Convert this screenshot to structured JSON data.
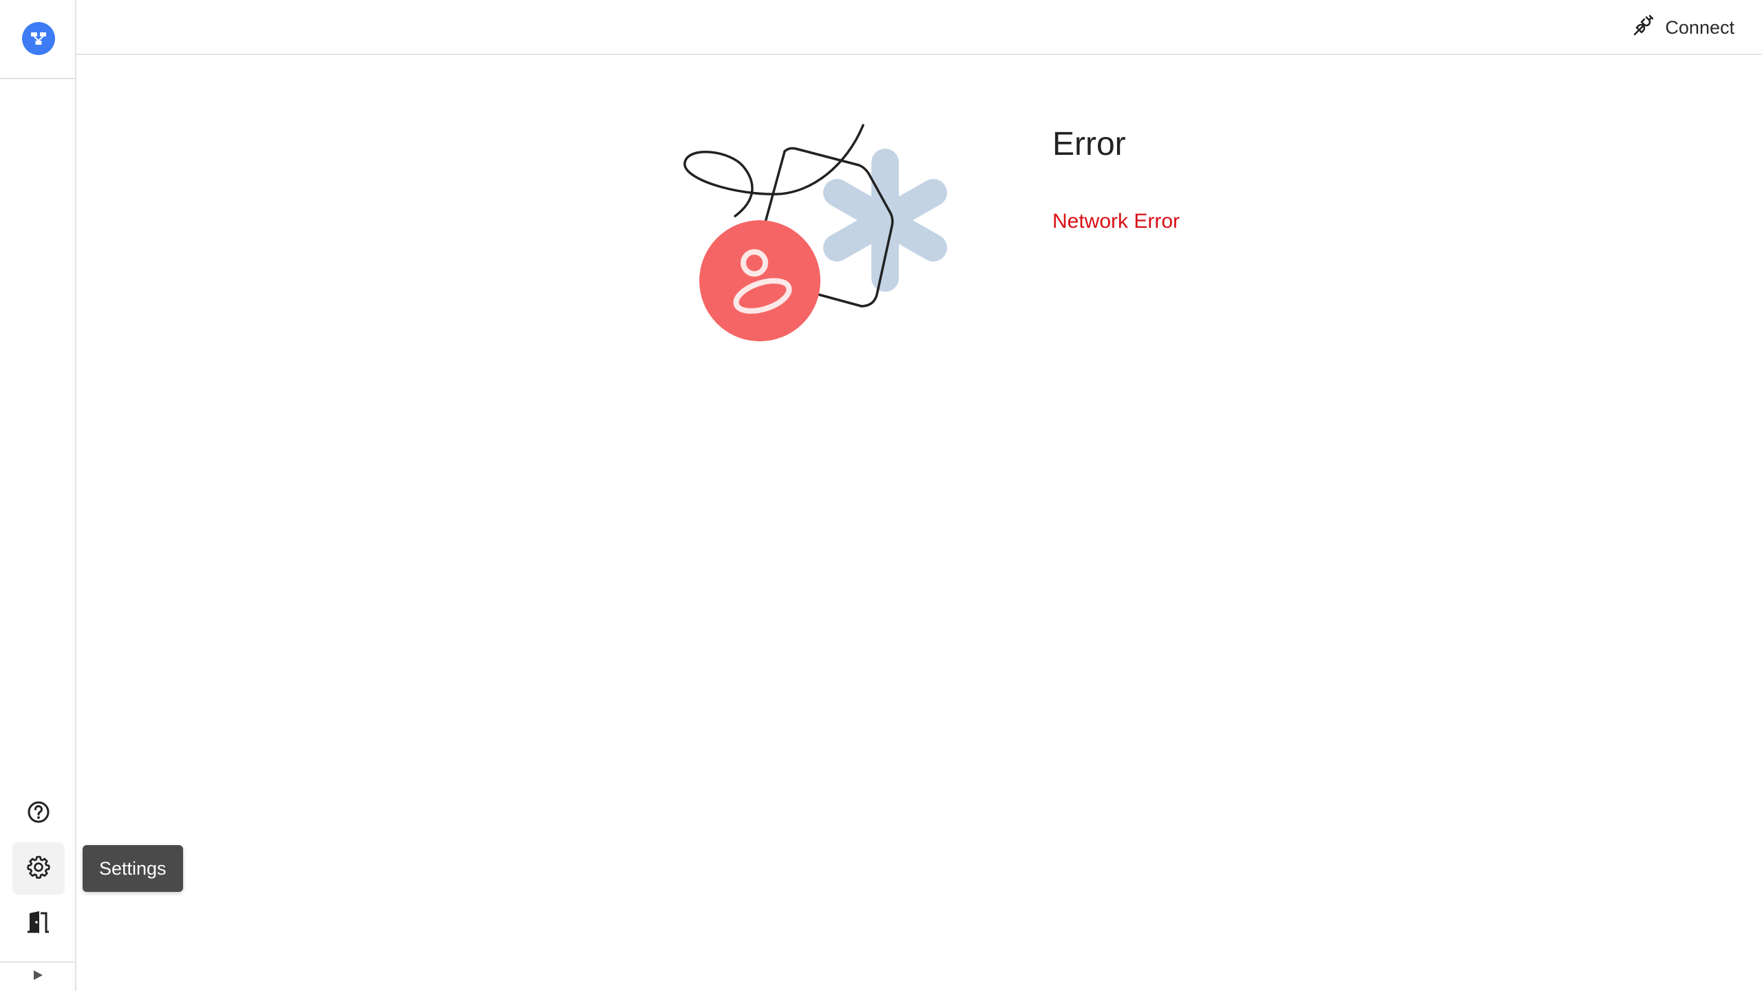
{
  "header": {
    "connect_label": "Connect",
    "connect_icon": "plug-icon"
  },
  "sidebar": {
    "logo_icon": "network-logo-icon",
    "items": [
      {
        "icon": "help-circle-icon",
        "label": "Help"
      },
      {
        "icon": "gear-icon",
        "label": "Settings",
        "active": true
      },
      {
        "icon": "logout-door-icon",
        "label": "Log out"
      }
    ],
    "expand_icon": "play-triangle-icon"
  },
  "tooltip": {
    "text": "Settings"
  },
  "main": {
    "title": "Error",
    "message": "Network Error"
  },
  "colors": {
    "accent": "#3d7cf4",
    "error": "#d80f16",
    "illustration_red": "#f56565",
    "illustration_blue": "#c3d3e4"
  }
}
